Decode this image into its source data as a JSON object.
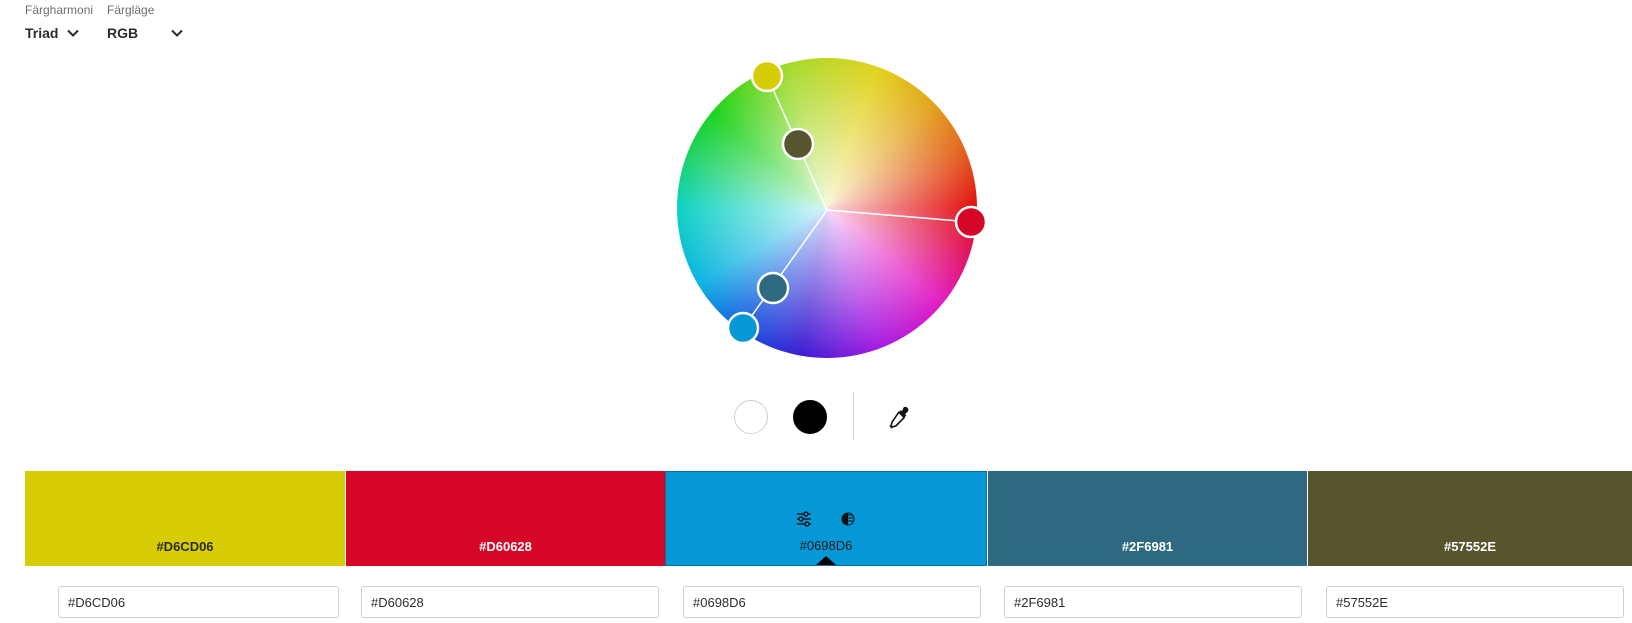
{
  "controls": {
    "harmony": {
      "label": "Färgharmoni",
      "value": "Triad"
    },
    "mode": {
      "label": "Färgläge",
      "value": "RGB"
    }
  },
  "wheel": {
    "handles": [
      {
        "name": "handle-yellow",
        "color": "#D6CD06"
      },
      {
        "name": "handle-red",
        "color": "#D60628"
      },
      {
        "name": "handle-blue",
        "color": "#0698D6"
      },
      {
        "name": "handle-teal",
        "color": "#2F6981"
      },
      {
        "name": "handle-olive",
        "color": "#57552E"
      }
    ]
  },
  "toolbar": {
    "white_icon": "white-circle-icon",
    "black_icon": "black-circle-icon",
    "eyedropper_icon": "eyedropper-icon"
  },
  "swatches": [
    {
      "hex": "#D6CD06",
      "color": "#D6CD06",
      "text_color": "#2c2c2c",
      "active": false
    },
    {
      "hex": "#D60628",
      "color": "#D60628",
      "text_color": "#ffffff",
      "active": false
    },
    {
      "hex": "#0698D6",
      "color": "#0698D6",
      "text_color": "#1c1c1c",
      "active": true,
      "tool_icons": [
        "sliders-icon",
        "contrast-icon"
      ]
    },
    {
      "hex": "#2F6981",
      "color": "#2F6981",
      "text_color": "#ffffff",
      "active": false
    },
    {
      "hex": "#57552E",
      "color": "#57552E",
      "text_color": "#ffffff",
      "active": false
    }
  ],
  "inputs": [
    "#D6CD06",
    "#D60628",
    "#0698D6",
    "#2F6981",
    "#57552E"
  ]
}
